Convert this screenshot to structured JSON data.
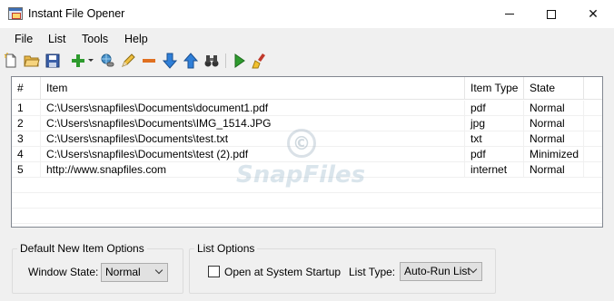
{
  "window": {
    "title": "Instant File Opener",
    "controls": {
      "minimize": "minimize",
      "maximize": "maximize",
      "close": "✕"
    }
  },
  "menu": [
    "File",
    "List",
    "Tools",
    "Help"
  ],
  "toolbar": {
    "icons": [
      "new-file-icon",
      "open-folder-icon",
      "save-icon",
      "add-icon",
      "link-icon",
      "edit-pencil-icon",
      "remove-icon",
      "move-down-icon",
      "move-up-icon",
      "binoculars-icon",
      "run-icon",
      "clear-broom-icon"
    ]
  },
  "list": {
    "columns": [
      "#",
      "Item",
      "Item Type",
      "State"
    ],
    "rows": [
      [
        "1",
        "C:\\Users\\snapfiles\\Documents\\document1.pdf",
        "pdf",
        "Normal"
      ],
      [
        "2",
        "C:\\Users\\snapfiles\\Documents\\IMG_1514.JPG",
        "jpg",
        "Normal"
      ],
      [
        "3",
        "C:\\Users\\snapfiles\\Documents\\test.txt",
        "txt",
        "Normal"
      ],
      [
        "4",
        "C:\\Users\\snapfiles\\Documents\\test (2).pdf",
        "pdf",
        "Minimized"
      ],
      [
        "5",
        "http://www.snapfiles.com",
        "internet",
        "Normal"
      ]
    ],
    "watermark_symbol": "©",
    "watermark_text": "SnapFiles"
  },
  "default_options": {
    "group_label": "Default New Item Options",
    "window_state_label": "Window State:",
    "window_state_value": "Normal"
  },
  "list_options": {
    "group_label": "List Options",
    "startup_label": "Open at System Startup",
    "startup_checked": false,
    "list_type_label": "List Type:",
    "list_type_value": "Auto-Run List"
  }
}
